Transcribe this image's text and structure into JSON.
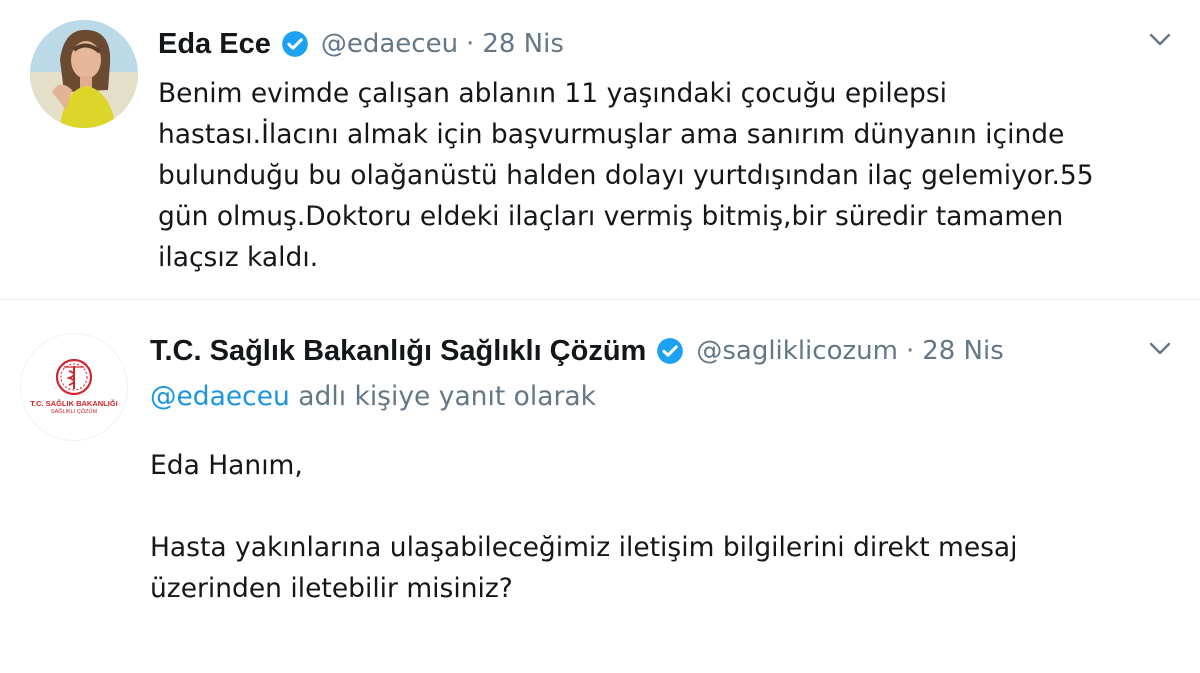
{
  "tweets": [
    {
      "author": {
        "name": "Eda Ece",
        "handle": "@edaeceu",
        "verified": true,
        "avatar_icon": "profile-photo"
      },
      "date": "28 Nis",
      "text": "Benim evimde çalışan ablanın 11 yaşındaki çocuğu epilepsi\nhastası.İlacını almak için başvurmuşlar ama sanırım dünyanın içinde\nbulunduğu bu olağanüstü halden dolayı yurtdışından ilaç gelemiyor.55\ngün olmuş.Doktoru eldeki ilaçları vermiş bitmiş,bir süredir tamamen\nilaçsız kaldı."
    },
    {
      "author": {
        "name": "T.C. Sağlık Bakanlığı Sağlıklı Çözüm",
        "handle": "@sagliklicozum",
        "verified": true,
        "avatar_icon": "ministry-logo",
        "avatar_label": "T.C. SAĞLIK BAKANLIĞI",
        "avatar_sublabel": "SAĞLIKLI ÇÖZÜM"
      },
      "date": "28 Nis",
      "reply_to": {
        "handle": "@edaeceu",
        "suffix": " adlı kişiye yanıt olarak"
      },
      "greeting": "Eda Hanım,",
      "message": "Hasta yakınlarına ulaşabileceğimiz iletişim bilgilerini direkt mesaj üzerinden iletebilir misiniz?"
    }
  ],
  "separator": "·",
  "colors": {
    "text": "#14171a",
    "secondary": "#657786",
    "link": "#1b95e0",
    "verified": "#1da1f2",
    "divider": "#e6ecf0",
    "logo_red": "#d0242e"
  },
  "icons": {
    "verified": "verified-badge-icon",
    "more": "chevron-down-icon"
  }
}
